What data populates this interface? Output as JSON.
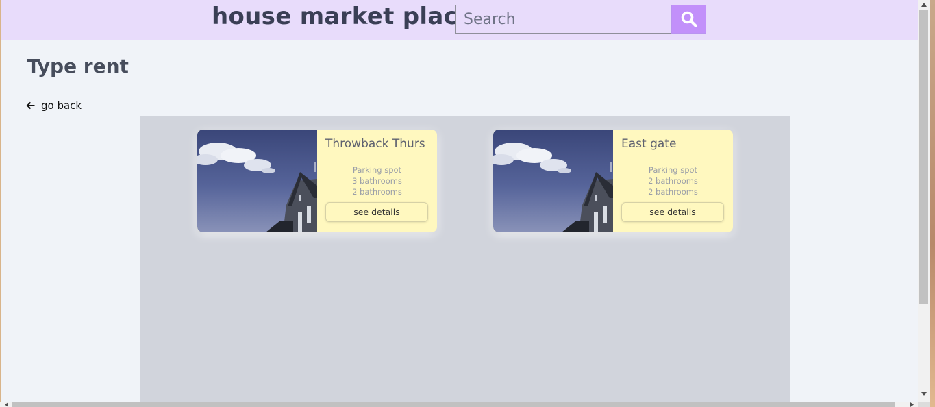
{
  "header": {
    "site_title": "house market place",
    "search_placeholder": "Search",
    "search_icon": "magnifier-icon",
    "accent_color": "#c290fa",
    "background_color": "#e8dcfb"
  },
  "page": {
    "title": "Type rent",
    "back_label": "go back",
    "back_icon": "arrow-left-icon"
  },
  "listings": [
    {
      "name": "Throwback Thurs",
      "features": [
        "Parking spot",
        "3 bathrooms",
        "2 bathrooms"
      ],
      "button_label": "see details",
      "image": "house-photo"
    },
    {
      "name": "East gate",
      "features": [
        "Parking spot",
        "2 bathrooms",
        "2 bathrooms"
      ],
      "button_label": "see details",
      "image": "house-photo"
    }
  ],
  "colors": {
    "card_background": "#fff8bf",
    "listing_area": "#d1d4dc",
    "page_background": "#f0f3f8"
  }
}
